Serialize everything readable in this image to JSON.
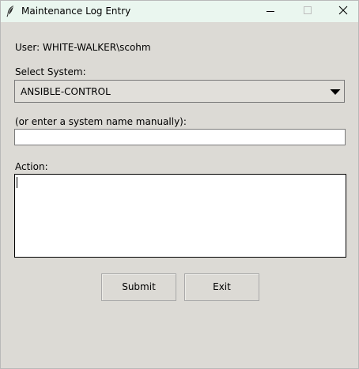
{
  "window": {
    "title": "Maintenance Log Entry",
    "controls": {
      "minimize": "minimize-icon",
      "maximize": "maximize-icon",
      "close": "close-icon"
    },
    "icon": "feather-icon"
  },
  "form": {
    "user_label": "User: WHITE-WALKER\\scohm",
    "select_label": "Select System:",
    "system_selected": "ANSIBLE-CONTROL",
    "manual_label": "(or enter a system name manually):",
    "manual_value": "",
    "action_label": "Action:",
    "action_value": ""
  },
  "buttons": {
    "submit_label": "Submit",
    "exit_label": "Exit"
  },
  "colors": {
    "window_bg": "#dcdad5",
    "titlebar_bg": "#eaf6ef",
    "input_bg": "#ffffff"
  }
}
